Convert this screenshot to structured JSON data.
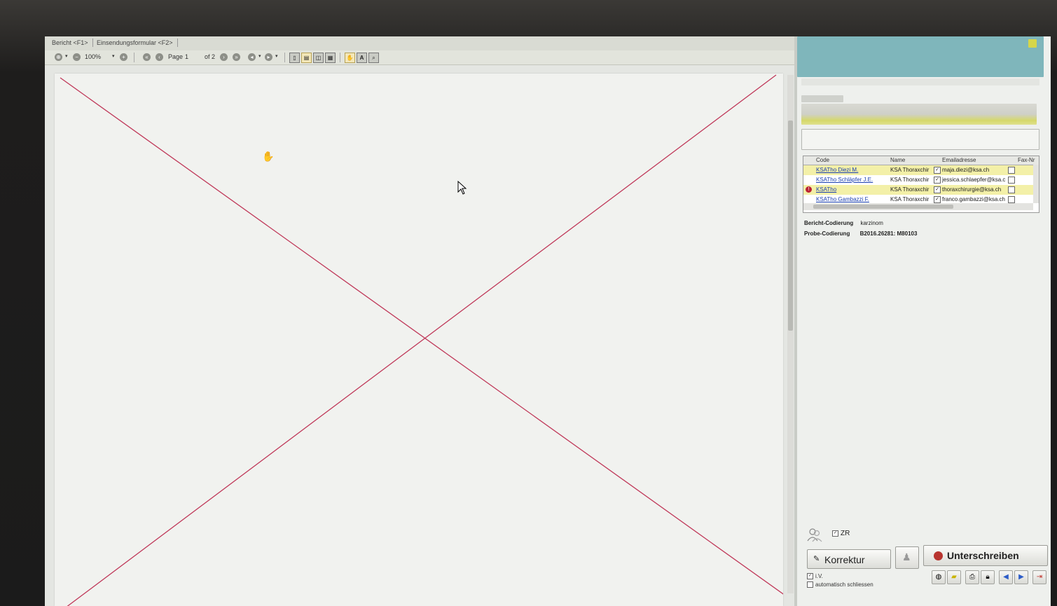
{
  "tabs": [
    "Bericht <F1>",
    "Einsendungsformular <F2>"
  ],
  "toolbar": {
    "zoom": "100%",
    "page_label": "Page",
    "page_number": "1",
    "page_of": "of 2"
  },
  "table": {
    "headers": [
      "Code",
      "Name",
      "Emailadresse",
      "Fax-Nr"
    ],
    "rows": [
      {
        "code": "KSATho Diezi M.",
        "name": "KSA Thoraxchir",
        "email": "maja.diezi@ksa.ch",
        "highlight": true,
        "warning": false
      },
      {
        "code": "KSATho Schläpfer J.E.",
        "name": "KSA Thoraxchir",
        "email": "jessica.schlaepfer@ksa.c",
        "highlight": false,
        "warning": false
      },
      {
        "code": "KSATho",
        "name": "KSA Thoraxchir",
        "email": "thoraxchirurgie@ksa.ch",
        "highlight": true,
        "warning": true
      },
      {
        "code": "KSATho Gambazzi F.",
        "name": "KSA Thoraxchir",
        "email": "franco.gambazzi@ksa.ch",
        "highlight": false,
        "warning": false
      }
    ]
  },
  "info": {
    "bericht_label": "Bericht-Codierung",
    "bericht_value": "karzinom",
    "probe_label": "Probe-Codierung",
    "probe_value": "B2016.26281: M80103"
  },
  "bottom": {
    "zr_label": "ZR",
    "korrektur": "Korrektur",
    "unterschreiben": "Unterschreiben",
    "iv_label": "i.V.",
    "auto_close_label": "automatisch schliessen"
  },
  "colors": {
    "cross_line": "#c0395a",
    "row_highlight": "#f3f0a8",
    "panel_header": "#7fb6bb"
  }
}
